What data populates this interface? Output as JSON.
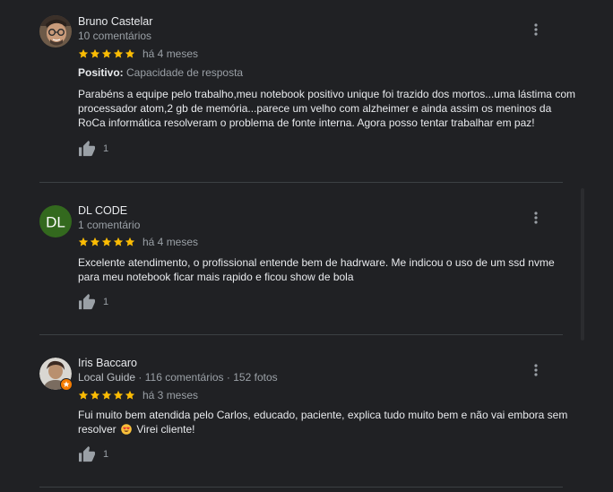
{
  "reviews": [
    {
      "name": "Bruno Castelar",
      "meta": "10 comentários",
      "date": "há 4 meses",
      "attribute_label": "Positivo:",
      "attribute_value": "Capacidade de resposta",
      "text": "Parabéns a equipe pelo trabalho,meu notebook positivo unique foi trazido dos mortos...uma lástima com processador atom,2 gb de memória...parece um velho com alzheimer e ainda assim os meninos da RoCa informática resolveram o problema de fonte interna. Agora posso tentar trabalhar em paz!",
      "likes": "1",
      "stars": 5
    },
    {
      "name": "DL CODE",
      "avatar_initials": "DL",
      "avatar_color": "#33691e",
      "meta": "1 comentário",
      "date": "há 4 meses",
      "text": "Excelente atendimento, o profissional entende bem de hadrware. Me indicou o uso de um ssd nvme para meu notebook ficar mais rapido e ficou show de bola",
      "likes": "1",
      "stars": 5
    },
    {
      "name": "Iris Baccaro",
      "local_guide": "Local Guide",
      "meta_separator": "·",
      "reviews_count": "116 comentários",
      "photos_count": "152 fotos",
      "date": "há 3 meses",
      "text_before_emoji": "Fui muito bem atendida pelo Carlos, educado, paciente, explica tudo muito bem e não vai embora sem resolver",
      "text_after_emoji": "Virei cliente!",
      "likes": "1",
      "stars": 5
    }
  ],
  "colors": {
    "background": "#202124",
    "star": "#fbbc04",
    "divider": "#3c4043",
    "local_guide_badge": "#f57c00"
  },
  "icons": {
    "more": "more-vert-icon",
    "like": "thumb-up-icon",
    "star": "star-icon",
    "emoji": "heart-eyes-emoji-icon"
  }
}
